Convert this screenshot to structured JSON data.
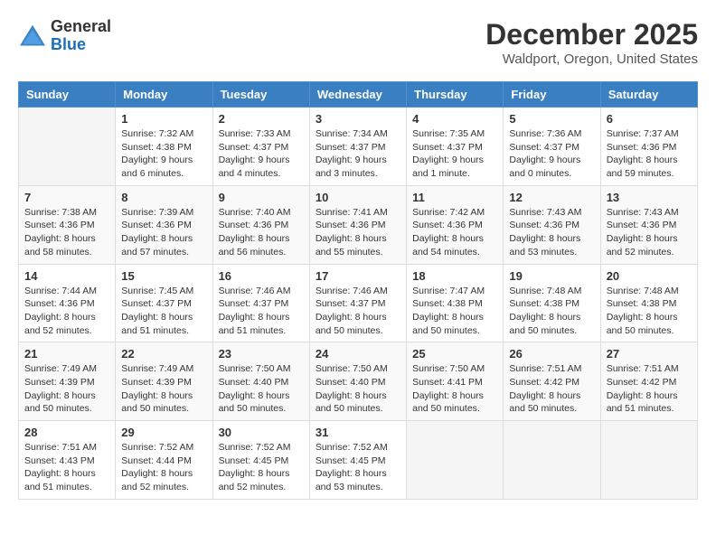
{
  "header": {
    "logo_general": "General",
    "logo_blue": "Blue",
    "month": "December 2025",
    "location": "Waldport, Oregon, United States"
  },
  "days_of_week": [
    "Sunday",
    "Monday",
    "Tuesday",
    "Wednesday",
    "Thursday",
    "Friday",
    "Saturday"
  ],
  "weeks": [
    [
      {
        "day": "",
        "info": ""
      },
      {
        "day": "1",
        "info": "Sunrise: 7:32 AM\nSunset: 4:38 PM\nDaylight: 9 hours\nand 6 minutes."
      },
      {
        "day": "2",
        "info": "Sunrise: 7:33 AM\nSunset: 4:37 PM\nDaylight: 9 hours\nand 4 minutes."
      },
      {
        "day": "3",
        "info": "Sunrise: 7:34 AM\nSunset: 4:37 PM\nDaylight: 9 hours\nand 3 minutes."
      },
      {
        "day": "4",
        "info": "Sunrise: 7:35 AM\nSunset: 4:37 PM\nDaylight: 9 hours\nand 1 minute."
      },
      {
        "day": "5",
        "info": "Sunrise: 7:36 AM\nSunset: 4:37 PM\nDaylight: 9 hours\nand 0 minutes."
      },
      {
        "day": "6",
        "info": "Sunrise: 7:37 AM\nSunset: 4:36 PM\nDaylight: 8 hours\nand 59 minutes."
      }
    ],
    [
      {
        "day": "7",
        "info": "Sunrise: 7:38 AM\nSunset: 4:36 PM\nDaylight: 8 hours\nand 58 minutes."
      },
      {
        "day": "8",
        "info": "Sunrise: 7:39 AM\nSunset: 4:36 PM\nDaylight: 8 hours\nand 57 minutes."
      },
      {
        "day": "9",
        "info": "Sunrise: 7:40 AM\nSunset: 4:36 PM\nDaylight: 8 hours\nand 56 minutes."
      },
      {
        "day": "10",
        "info": "Sunrise: 7:41 AM\nSunset: 4:36 PM\nDaylight: 8 hours\nand 55 minutes."
      },
      {
        "day": "11",
        "info": "Sunrise: 7:42 AM\nSunset: 4:36 PM\nDaylight: 8 hours\nand 54 minutes."
      },
      {
        "day": "12",
        "info": "Sunrise: 7:43 AM\nSunset: 4:36 PM\nDaylight: 8 hours\nand 53 minutes."
      },
      {
        "day": "13",
        "info": "Sunrise: 7:43 AM\nSunset: 4:36 PM\nDaylight: 8 hours\nand 52 minutes."
      }
    ],
    [
      {
        "day": "14",
        "info": "Sunrise: 7:44 AM\nSunset: 4:36 PM\nDaylight: 8 hours\nand 52 minutes."
      },
      {
        "day": "15",
        "info": "Sunrise: 7:45 AM\nSunset: 4:37 PM\nDaylight: 8 hours\nand 51 minutes."
      },
      {
        "day": "16",
        "info": "Sunrise: 7:46 AM\nSunset: 4:37 PM\nDaylight: 8 hours\nand 51 minutes."
      },
      {
        "day": "17",
        "info": "Sunrise: 7:46 AM\nSunset: 4:37 PM\nDaylight: 8 hours\nand 50 minutes."
      },
      {
        "day": "18",
        "info": "Sunrise: 7:47 AM\nSunset: 4:38 PM\nDaylight: 8 hours\nand 50 minutes."
      },
      {
        "day": "19",
        "info": "Sunrise: 7:48 AM\nSunset: 4:38 PM\nDaylight: 8 hours\nand 50 minutes."
      },
      {
        "day": "20",
        "info": "Sunrise: 7:48 AM\nSunset: 4:38 PM\nDaylight: 8 hours\nand 50 minutes."
      }
    ],
    [
      {
        "day": "21",
        "info": "Sunrise: 7:49 AM\nSunset: 4:39 PM\nDaylight: 8 hours\nand 50 minutes."
      },
      {
        "day": "22",
        "info": "Sunrise: 7:49 AM\nSunset: 4:39 PM\nDaylight: 8 hours\nand 50 minutes."
      },
      {
        "day": "23",
        "info": "Sunrise: 7:50 AM\nSunset: 4:40 PM\nDaylight: 8 hours\nand 50 minutes."
      },
      {
        "day": "24",
        "info": "Sunrise: 7:50 AM\nSunset: 4:40 PM\nDaylight: 8 hours\nand 50 minutes."
      },
      {
        "day": "25",
        "info": "Sunrise: 7:50 AM\nSunset: 4:41 PM\nDaylight: 8 hours\nand 50 minutes."
      },
      {
        "day": "26",
        "info": "Sunrise: 7:51 AM\nSunset: 4:42 PM\nDaylight: 8 hours\nand 50 minutes."
      },
      {
        "day": "27",
        "info": "Sunrise: 7:51 AM\nSunset: 4:42 PM\nDaylight: 8 hours\nand 51 minutes."
      }
    ],
    [
      {
        "day": "28",
        "info": "Sunrise: 7:51 AM\nSunset: 4:43 PM\nDaylight: 8 hours\nand 51 minutes."
      },
      {
        "day": "29",
        "info": "Sunrise: 7:52 AM\nSunset: 4:44 PM\nDaylight: 8 hours\nand 52 minutes."
      },
      {
        "day": "30",
        "info": "Sunrise: 7:52 AM\nSunset: 4:45 PM\nDaylight: 8 hours\nand 52 minutes."
      },
      {
        "day": "31",
        "info": "Sunrise: 7:52 AM\nSunset: 4:45 PM\nDaylight: 8 hours\nand 53 minutes."
      },
      {
        "day": "",
        "info": ""
      },
      {
        "day": "",
        "info": ""
      },
      {
        "day": "",
        "info": ""
      }
    ]
  ]
}
